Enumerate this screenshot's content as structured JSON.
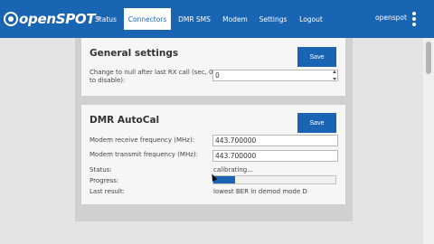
{
  "brand": {
    "name": "openSPOT",
    "tm": "®"
  },
  "nav": {
    "items": [
      {
        "label": "Status"
      },
      {
        "label": "Connectors"
      },
      {
        "label": "DMR SMS"
      },
      {
        "label": "Modem"
      },
      {
        "label": "Settings"
      },
      {
        "label": "Logout"
      }
    ],
    "active": "Connectors",
    "hostname": "openspot"
  },
  "general_settings": {
    "title": "General settings",
    "save_label": "Save",
    "null_timeout_label": "Change to null after last RX call (sec, 0 to disable):",
    "null_timeout_value": "0"
  },
  "dmr_autocal": {
    "title": "DMR AutoCal",
    "save_label": "Save",
    "rx_freq_label": "Modem receive frequency (MHz):",
    "rx_freq_value": "443.700000",
    "tx_freq_label": "Modem transmit frequency (MHz):",
    "tx_freq_value": "443.700000",
    "status_label": "Status:",
    "status_value": "calibrating...",
    "progress_label": "Progress:",
    "progress_fraction": 0.18,
    "last_result_label": "Last result:",
    "last_result_value": "lowest BER in demod mode D"
  },
  "colors": {
    "accent": "#1a64b4",
    "background": "#e4e4e4",
    "panel": "#d0d0d0",
    "card": "#f6f6f6"
  }
}
